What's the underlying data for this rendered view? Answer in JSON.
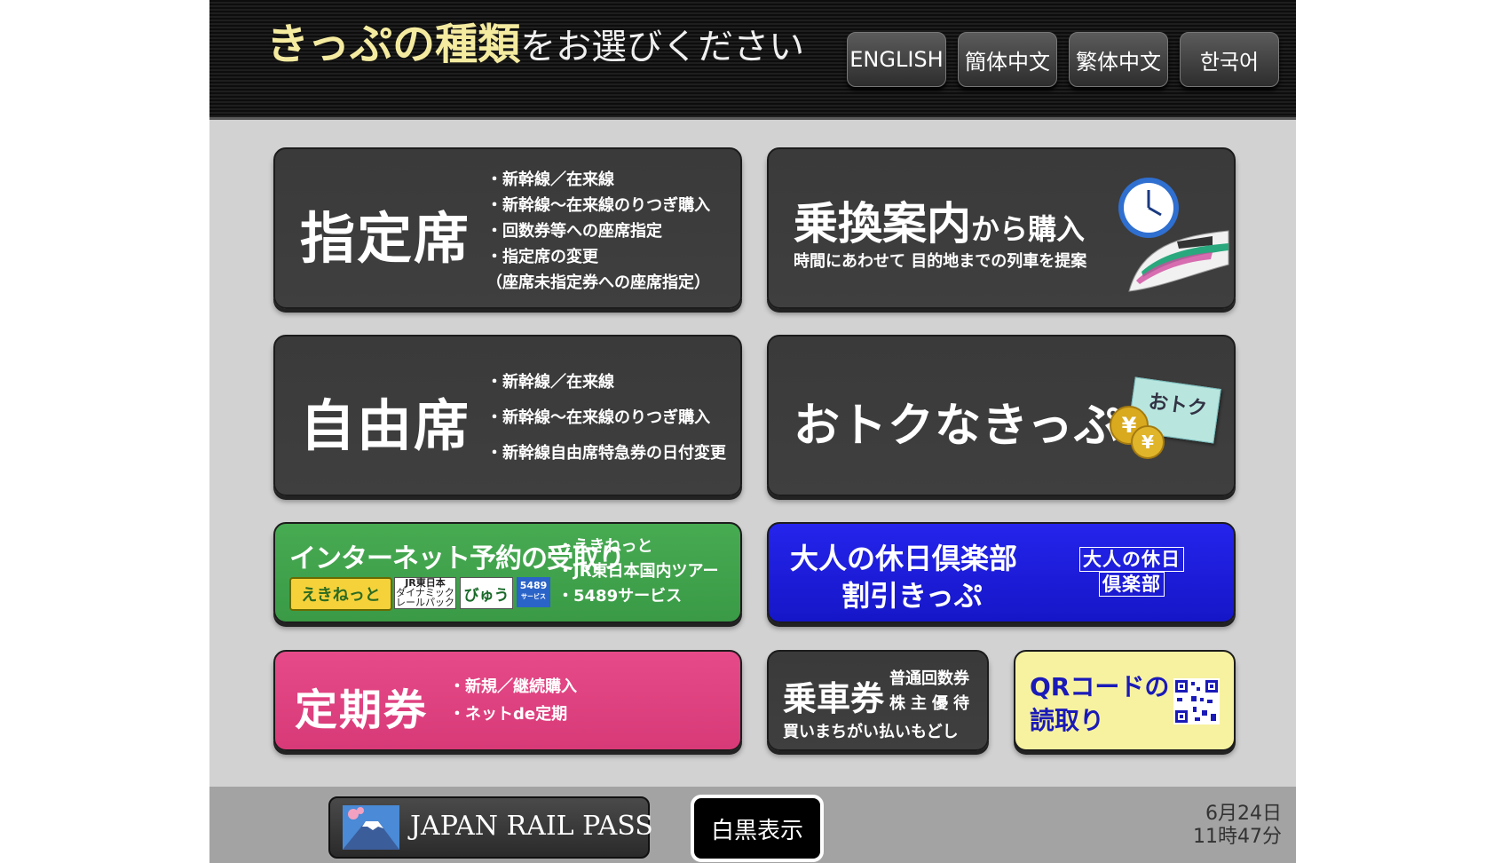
{
  "header": {
    "title_highlight": "きっぷの種類",
    "title_rest": "をお選びください",
    "languages": [
      "ENGLISH",
      "簡体中文",
      "繁体中文",
      "한국어"
    ]
  },
  "reserved": {
    "label": "指定席",
    "bullets": [
      "・新幹線／在来線",
      "・新幹線～在来線のりつぎ購入",
      "・回数券等への座席指定",
      "・指定席の変更",
      "（座席未指定券への座席指定）"
    ]
  },
  "transfer": {
    "label_main": "乗換案内",
    "label_sub": "から購入",
    "subtitle": "時間にあわせて 目的地までの列車を提案",
    "icons": [
      "clock-icon",
      "shinkansen-icon"
    ]
  },
  "nonreserved": {
    "label": "自由席",
    "bullets": [
      "・新幹線／在来線",
      "・新幹線～在来線のりつぎ購入",
      "・新幹線自由席特急券の日付変更"
    ]
  },
  "discount": {
    "label": "おトクなきっぷ",
    "tag": "おトク",
    "coin": "¥"
  },
  "internet": {
    "label": "インターネット予約の受取り",
    "logos": [
      "えきねっと",
      "JR東日本",
      "ダイナミック",
      "レールパック",
      "びゅう",
      "5489",
      "サービス"
    ],
    "bullets": [
      "・えきねっと",
      "・JR東日本国内ツアー",
      "・5489サービス"
    ],
    "color": "#3a9a46"
  },
  "club": {
    "line1": "大人の休日倶楽部",
    "line2": "割引きっぷ",
    "logo1": "大人の休日",
    "logo2": "倶楽部",
    "color": "#1a1ad8"
  },
  "commuter": {
    "label": "定期券",
    "bullets": [
      "・新規／継続購入",
      "・ネットde定期"
    ],
    "color": "#dd3e7c"
  },
  "ticket": {
    "label": "乗車券",
    "side1": "普通回数券",
    "side2": "株主優待",
    "bottom": "買いまちがい払いもどし"
  },
  "qr": {
    "line1": "QRコードの",
    "line2": "読取り",
    "color": "#f7f2a0"
  },
  "footer": {
    "jrp_label": "JAPAN RAIL PASS",
    "mono_label": "白黒表示",
    "date": "6月24日",
    "time": "11時47分"
  }
}
